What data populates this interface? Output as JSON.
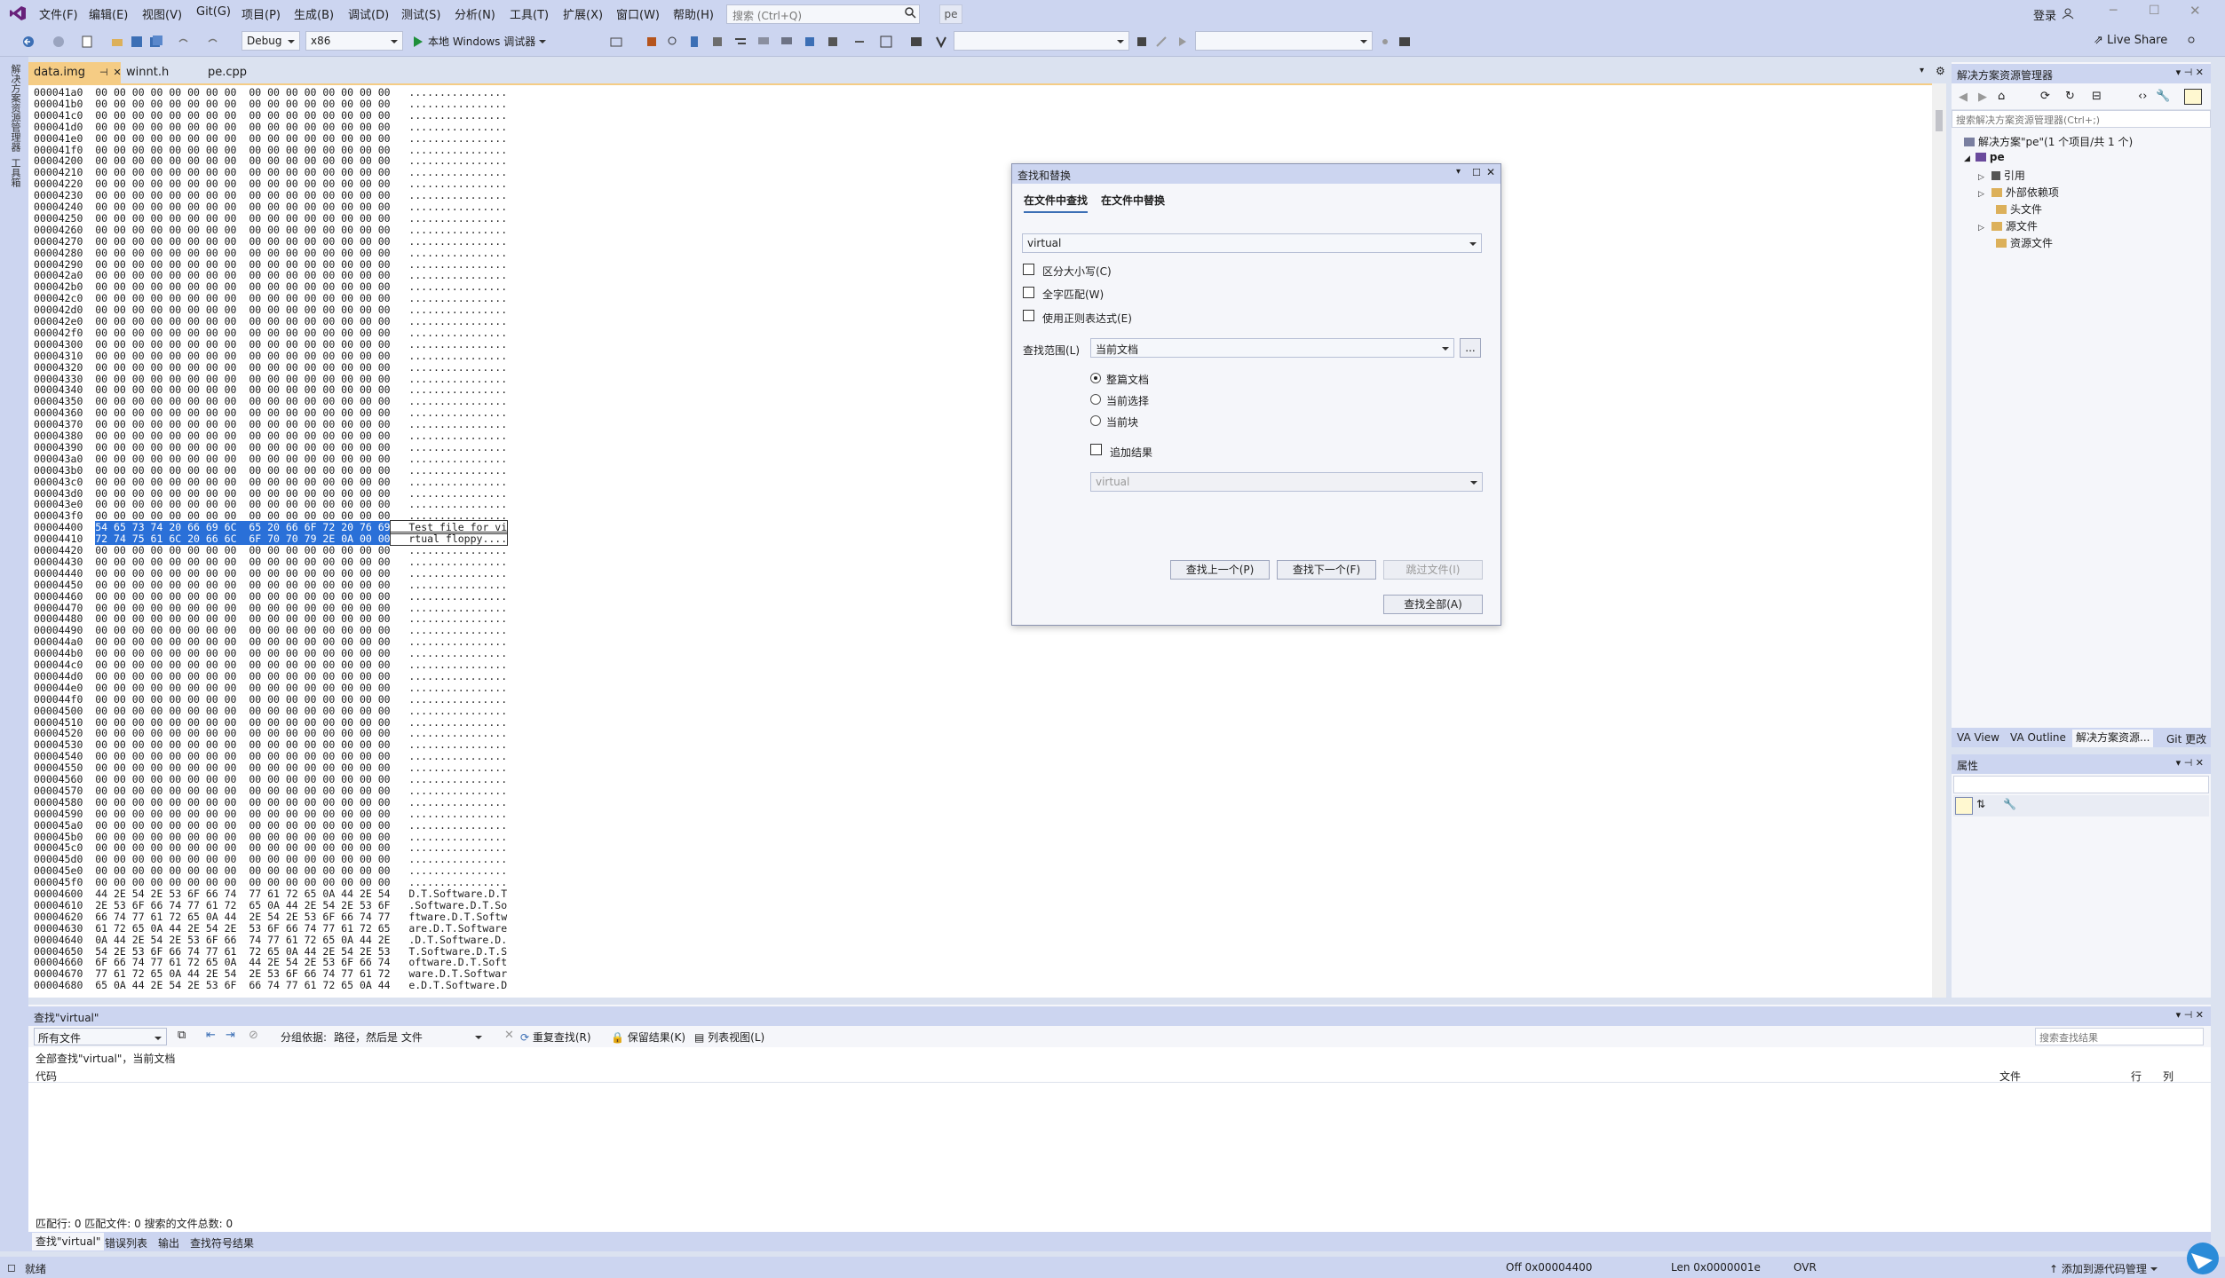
{
  "menu": [
    "文件(F)",
    "编辑(E)",
    "视图(V)",
    "Git(G)",
    "项目(P)",
    "生成(B)",
    "调试(D)",
    "测试(S)",
    "分析(N)",
    "工具(T)",
    "扩展(X)",
    "窗口(W)",
    "帮助(H)"
  ],
  "search_placeholder": "搜索 (Ctrl+Q)",
  "project_badge": "pe",
  "login_label": "登录",
  "toolbar": {
    "config": "Debug",
    "platform": "x86",
    "run_label": "本地 Windows 调试器",
    "live_share": "Live Share"
  },
  "left_strip": {
    "item1": "解决方案资源管理器",
    "item2": "工具箱"
  },
  "doc_tabs": [
    "data.img",
    "winnt.h",
    "pe.cpp"
  ],
  "hex_lines": [
    "000041a0  00 00 00 00 00 00 00 00  00 00 00 00 00 00 00 00   ................",
    "000041b0  00 00 00 00 00 00 00 00  00 00 00 00 00 00 00 00   ................",
    "000041c0  00 00 00 00 00 00 00 00  00 00 00 00 00 00 00 00   ................",
    "000041d0  00 00 00 00 00 00 00 00  00 00 00 00 00 00 00 00   ................",
    "000041e0  00 00 00 00 00 00 00 00  00 00 00 00 00 00 00 00   ................",
    "000041f0  00 00 00 00 00 00 00 00  00 00 00 00 00 00 00 00   ................",
    "00004200  00 00 00 00 00 00 00 00  00 00 00 00 00 00 00 00   ................",
    "00004210  00 00 00 00 00 00 00 00  00 00 00 00 00 00 00 00   ................",
    "00004220  00 00 00 00 00 00 00 00  00 00 00 00 00 00 00 00   ................",
    "00004230  00 00 00 00 00 00 00 00  00 00 00 00 00 00 00 00   ................",
    "00004240  00 00 00 00 00 00 00 00  00 00 00 00 00 00 00 00   ................",
    "00004250  00 00 00 00 00 00 00 00  00 00 00 00 00 00 00 00   ................",
    "00004260  00 00 00 00 00 00 00 00  00 00 00 00 00 00 00 00   ................",
    "00004270  00 00 00 00 00 00 00 00  00 00 00 00 00 00 00 00   ................",
    "00004280  00 00 00 00 00 00 00 00  00 00 00 00 00 00 00 00   ................",
    "00004290  00 00 00 00 00 00 00 00  00 00 00 00 00 00 00 00   ................",
    "000042a0  00 00 00 00 00 00 00 00  00 00 00 00 00 00 00 00   ................",
    "000042b0  00 00 00 00 00 00 00 00  00 00 00 00 00 00 00 00   ................",
    "000042c0  00 00 00 00 00 00 00 00  00 00 00 00 00 00 00 00   ................",
    "000042d0  00 00 00 00 00 00 00 00  00 00 00 00 00 00 00 00   ................",
    "000042e0  00 00 00 00 00 00 00 00  00 00 00 00 00 00 00 00   ................",
    "000042f0  00 00 00 00 00 00 00 00  00 00 00 00 00 00 00 00   ................",
    "00004300  00 00 00 00 00 00 00 00  00 00 00 00 00 00 00 00   ................",
    "00004310  00 00 00 00 00 00 00 00  00 00 00 00 00 00 00 00   ................",
    "00004320  00 00 00 00 00 00 00 00  00 00 00 00 00 00 00 00   ................",
    "00004330  00 00 00 00 00 00 00 00  00 00 00 00 00 00 00 00   ................",
    "00004340  00 00 00 00 00 00 00 00  00 00 00 00 00 00 00 00   ................",
    "00004350  00 00 00 00 00 00 00 00  00 00 00 00 00 00 00 00   ................",
    "00004360  00 00 00 00 00 00 00 00  00 00 00 00 00 00 00 00   ................",
    "00004370  00 00 00 00 00 00 00 00  00 00 00 00 00 00 00 00   ................",
    "00004380  00 00 00 00 00 00 00 00  00 00 00 00 00 00 00 00   ................",
    "00004390  00 00 00 00 00 00 00 00  00 00 00 00 00 00 00 00   ................",
    "000043a0  00 00 00 00 00 00 00 00  00 00 00 00 00 00 00 00   ................",
    "000043b0  00 00 00 00 00 00 00 00  00 00 00 00 00 00 00 00   ................",
    "000043c0  00 00 00 00 00 00 00 00  00 00 00 00 00 00 00 00   ................",
    "000043d0  00 00 00 00 00 00 00 00  00 00 00 00 00 00 00 00   ................",
    "000043e0  00 00 00 00 00 00 00 00  00 00 00 00 00 00 00 00   ................",
    "000043f0  00 00 00 00 00 00 00 00  00 00 00 00 00 00 00 00   ................",
    "00004400  54 65 73 74 20 66 69 6C  65 20 66 6F 72 20 76 69   Test file for vi",
    "00004410  72 74 75 61 6C 20 66 6C  6F 70 70 79 2E 0A 00 00   rtual floppy....",
    "00004420  00 00 00 00 00 00 00 00  00 00 00 00 00 00 00 00   ................",
    "00004430  00 00 00 00 00 00 00 00  00 00 00 00 00 00 00 00   ................",
    "00004440  00 00 00 00 00 00 00 00  00 00 00 00 00 00 00 00   ................",
    "00004450  00 00 00 00 00 00 00 00  00 00 00 00 00 00 00 00   ................",
    "00004460  00 00 00 00 00 00 00 00  00 00 00 00 00 00 00 00   ................",
    "00004470  00 00 00 00 00 00 00 00  00 00 00 00 00 00 00 00   ................",
    "00004480  00 00 00 00 00 00 00 00  00 00 00 00 00 00 00 00   ................",
    "00004490  00 00 00 00 00 00 00 00  00 00 00 00 00 00 00 00   ................",
    "000044a0  00 00 00 00 00 00 00 00  00 00 00 00 00 00 00 00   ................",
    "000044b0  00 00 00 00 00 00 00 00  00 00 00 00 00 00 00 00   ................",
    "000044c0  00 00 00 00 00 00 00 00  00 00 00 00 00 00 00 00   ................",
    "000044d0  00 00 00 00 00 00 00 00  00 00 00 00 00 00 00 00   ................",
    "000044e0  00 00 00 00 00 00 00 00  00 00 00 00 00 00 00 00   ................",
    "000044f0  00 00 00 00 00 00 00 00  00 00 00 00 00 00 00 00   ................",
    "00004500  00 00 00 00 00 00 00 00  00 00 00 00 00 00 00 00   ................",
    "00004510  00 00 00 00 00 00 00 00  00 00 00 00 00 00 00 00   ................",
    "00004520  00 00 00 00 00 00 00 00  00 00 00 00 00 00 00 00   ................",
    "00004530  00 00 00 00 00 00 00 00  00 00 00 00 00 00 00 00   ................",
    "00004540  00 00 00 00 00 00 00 00  00 00 00 00 00 00 00 00   ................",
    "00004550  00 00 00 00 00 00 00 00  00 00 00 00 00 00 00 00   ................",
    "00004560  00 00 00 00 00 00 00 00  00 00 00 00 00 00 00 00   ................",
    "00004570  00 00 00 00 00 00 00 00  00 00 00 00 00 00 00 00   ................",
    "00004580  00 00 00 00 00 00 00 00  00 00 00 00 00 00 00 00   ................",
    "00004590  00 00 00 00 00 00 00 00  00 00 00 00 00 00 00 00   ................",
    "000045a0  00 00 00 00 00 00 00 00  00 00 00 00 00 00 00 00   ................",
    "000045b0  00 00 00 00 00 00 00 00  00 00 00 00 00 00 00 00   ................",
    "000045c0  00 00 00 00 00 00 00 00  00 00 00 00 00 00 00 00   ................",
    "000045d0  00 00 00 00 00 00 00 00  00 00 00 00 00 00 00 00   ................",
    "000045e0  00 00 00 00 00 00 00 00  00 00 00 00 00 00 00 00   ................",
    "000045f0  00 00 00 00 00 00 00 00  00 00 00 00 00 00 00 00   ................",
    "00004600  44 2E 54 2E 53 6F 66 74  77 61 72 65 0A 44 2E 54   D.T.Software.D.T",
    "00004610  2E 53 6F 66 74 77 61 72  65 0A 44 2E 54 2E 53 6F   .Software.D.T.So",
    "00004620  66 74 77 61 72 65 0A 44  2E 54 2E 53 6F 66 74 77   ftware.D.T.Softw",
    "00004630  61 72 65 0A 44 2E 54 2E  53 6F 66 74 77 61 72 65   are.D.T.Software",
    "00004640  0A 44 2E 54 2E 53 6F 66  74 77 61 72 65 0A 44 2E   .D.T.Software.D.",
    "00004650  54 2E 53 6F 66 74 77 61  72 65 0A 44 2E 54 2E 53   T.Software.D.T.S",
    "00004660  6F 66 74 77 61 72 65 0A  44 2E 54 2E 53 6F 66 74   oftware.D.T.Soft",
    "00004670  77 61 72 65 0A 44 2E 54  2E 53 6F 66 74 77 61 72   ware.D.T.Softwar",
    "00004680  65 0A 44 2E 54 2E 53 6F  66 74 77 61 72 65 0A 44   e.D.T.Software.D"
  ],
  "find_dialog": {
    "title": "查找和替换",
    "tab_find": "在文件中查找",
    "tab_replace": "在文件中替换",
    "search_value": "virtual",
    "match_case": "区分大小写(C)",
    "whole_word": "全字匹配(W)",
    "regex": "使用正则表达式(E)",
    "scope_label": "查找范围(L)",
    "scope_value": "当前文档",
    "browse": "...",
    "radio_whole": "整篇文档",
    "radio_selection": "当前选择",
    "radio_block": "当前块",
    "append_results": "追加结果",
    "filter_value": "virtual",
    "btn_prev": "查找上一个(P)",
    "btn_next": "查找下一个(F)",
    "btn_skip": "跳过文件(I)",
    "btn_all": "查找全部(A)"
  },
  "solution": {
    "title": "解决方案资源管理器",
    "search_placeholder": "搜索解决方案资源管理器(Ctrl+;)",
    "root": "解决方案\"pe\"(1 个项目/共 1 个)",
    "project": "pe",
    "items": [
      "引用",
      "外部依赖项",
      "头文件",
      "源文件",
      "资源文件"
    ]
  },
  "right_tabs": [
    "VA View",
    "VA Outline",
    "解决方案资源...",
    "Git 更改"
  ],
  "properties_title": "属性",
  "results": {
    "title": "查找\"virtual\"",
    "scope_combo": "所有文件",
    "group_label": "分组依据:",
    "group_value": "路径，然后是 文件",
    "repeat": "重复查找(R)",
    "keep": "保留结果(K)",
    "list_view": "列表视图(L)",
    "search_placeholder": "搜索查找结果",
    "summary": "全部查找\"virtual\"，当前文档",
    "col_code": "代码",
    "col_file": "文件",
    "col_line": "行",
    "col_col": "列",
    "footer": "匹配行: 0 匹配文件: 0 搜索的文件总数: 0"
  },
  "bottom_tabs": [
    "查找\"virtual\"",
    "错误列表",
    "输出",
    "查找符号结果"
  ],
  "status": {
    "ready": "就绪",
    "offset": "Off 0x00004400",
    "length": "Len 0x0000001e",
    "ovr": "OVR",
    "source_control": "添加到源代码管理"
  }
}
